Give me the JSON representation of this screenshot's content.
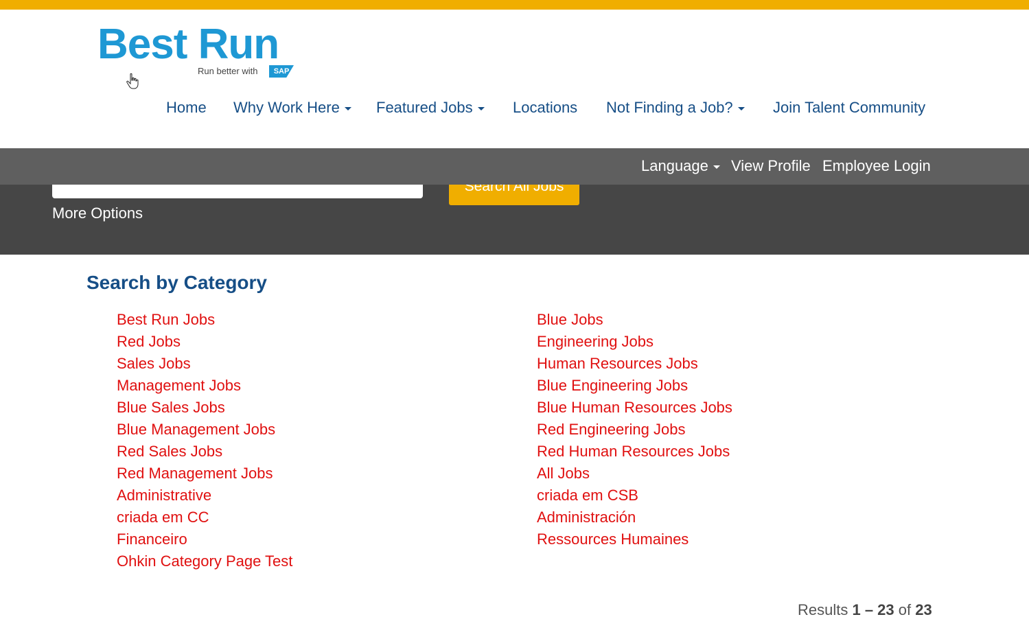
{
  "header": {
    "logo": {
      "wordmark": "Best Run",
      "tagline": "Run better with",
      "badge": "SAP"
    },
    "nav": [
      {
        "label": "Home",
        "dropdown": false
      },
      {
        "label": "Why Work Here",
        "dropdown": true
      },
      {
        "label": "Featured Jobs",
        "dropdown": true
      },
      {
        "label": "Locations",
        "dropdown": false
      },
      {
        "label": "Not Finding a Job?",
        "dropdown": true
      },
      {
        "label": "Join Talent Community",
        "dropdown": false
      }
    ]
  },
  "utility_bar": {
    "language": "Language",
    "view_profile": "View Profile",
    "employee_login": "Employee Login"
  },
  "search": {
    "input_value": "",
    "button_label": "Search All Jobs",
    "more_options": "More Options"
  },
  "categories": {
    "title": "Search by Category",
    "left": [
      "Best Run Jobs",
      "Red Jobs",
      "Sales Jobs",
      "Management Jobs",
      "Blue Sales Jobs",
      "Blue Management Jobs",
      "Red Sales Jobs",
      "Red Management Jobs",
      "Administrative",
      "criada em CC",
      "Financeiro",
      "Ohkin Category Page Test"
    ],
    "right": [
      "Blue Jobs",
      "Engineering Jobs",
      "Human Resources Jobs",
      "Blue Engineering Jobs",
      "Blue Human Resources Jobs",
      "Red Engineering Jobs",
      "Red Human Resources Jobs",
      "All Jobs",
      "criada em CSB",
      "Administración",
      "Ressources Humaines"
    ]
  },
  "results": {
    "prefix": "Results",
    "range": "1 – 23",
    "of": "of",
    "total": "23"
  },
  "colors": {
    "accent": "#f0ae00",
    "nav_text": "#164e86",
    "category_link": "#e01010",
    "utility_bar": "#5f5f5f",
    "search_band": "#464646",
    "logo_blue": "#1e98d4"
  }
}
